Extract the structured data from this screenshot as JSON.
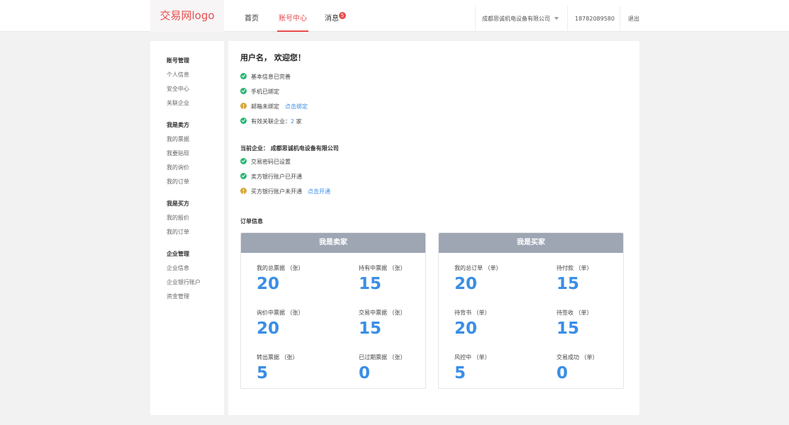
{
  "header": {
    "logo": "交易网logo",
    "nav": [
      "首页",
      "账号中心",
      "消息"
    ],
    "message_badge": "5",
    "company": "成都思诚机电设备有限公司",
    "phone": "18782089580",
    "logout": "退出"
  },
  "sidebar": {
    "groups": [
      {
        "title": "账号管理",
        "items": [
          "个人信息",
          "安全中心",
          "关联企业"
        ]
      },
      {
        "title": "我是卖方",
        "items": [
          "我的票据",
          "我要贴现",
          "我的询价",
          "我的订单"
        ]
      },
      {
        "title": "我是买方",
        "items": [
          "我的报价",
          "我的订单"
        ]
      },
      {
        "title": "企业管理",
        "items": [
          "企业信息",
          "企业银行账户",
          "资金管理"
        ]
      }
    ]
  },
  "main": {
    "welcome": "用户名， 欢迎您！",
    "user_status": {
      "basic_info": "基本信息已完善",
      "phone": "手机已绑定",
      "email": "邮箱未绑定",
      "email_link": "点击绑定",
      "companies_prefix": "有效关联企业：",
      "companies_count": "2",
      "companies_suffix": " 家"
    },
    "current_company": "当前企业： 成都思诚机电设备有限公司",
    "company_status": {
      "trade_password": "交易密码已设置",
      "seller_account": "卖方银行账户已开通",
      "buyer_account": "买方银行账户未开通",
      "buyer_link": "点击开通"
    },
    "orders_label": "订单信息",
    "seller_card": {
      "title": "我是卖家",
      "stats": [
        {
          "label": "我的总票据 （张）",
          "value": "20"
        },
        {
          "label": "持有中票据 （张）",
          "value": "15"
        },
        {
          "label": "询价中票据 （张）",
          "value": "20"
        },
        {
          "label": "交易中票据 （张）",
          "value": "15"
        },
        {
          "label": "转出票据 （张）",
          "value": "5"
        },
        {
          "label": "已过期票据 （张）",
          "value": "0"
        }
      ]
    },
    "buyer_card": {
      "title": "我是买家",
      "stats": [
        {
          "label": "我的总订单 （单）",
          "value": "20"
        },
        {
          "label": "待付款 （单）",
          "value": "15"
        },
        {
          "label": "待背书 （单）",
          "value": "20"
        },
        {
          "label": "待签收 （单）",
          "value": "15"
        },
        {
          "label": "风控中 （单）",
          "value": "5"
        },
        {
          "label": "交易成功 （单）",
          "value": "0"
        }
      ]
    }
  },
  "colors": {
    "accent": "#e84c4c",
    "link": "#3a8ee6",
    "success": "#2bb673",
    "warning": "#d6a93a",
    "card_header": "#9ea6b4"
  }
}
